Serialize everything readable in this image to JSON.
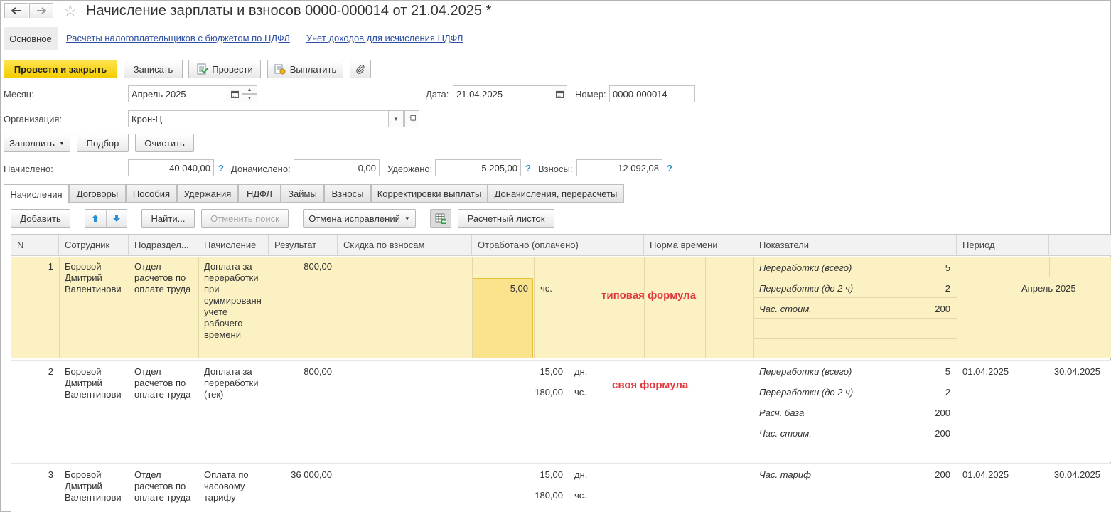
{
  "window": {
    "title": "Начисление зарплаты и взносов 0000-000014 от 21.04.2025 *"
  },
  "subnav": {
    "main": "Основное",
    "link1": "Расчеты налогоплательщиков с бюджетом по НДФЛ",
    "link2": "Учет доходов для исчисления НДФЛ"
  },
  "toolbar": {
    "post_close": "Провести и закрыть",
    "save": "Записать",
    "post": "Провести",
    "pay": "Выплатить"
  },
  "form": {
    "month_label": "Месяц:",
    "month_value": "Апрель 2025",
    "date_label": "Дата:",
    "date_value": "21.04.2025",
    "number_label": "Номер:",
    "number_value": "0000-000014",
    "org_label": "Организация:",
    "org_value": "Крон-Ц"
  },
  "actions": {
    "fill": "Заполнить",
    "pick": "Подбор",
    "clear": "Очистить"
  },
  "totals": {
    "accrued_label": "Начислено:",
    "accrued_value": "40 040,00",
    "additional_label": "Доначислено:",
    "additional_value": "0,00",
    "withheld_label": "Удержано:",
    "withheld_value": "5 205,00",
    "contributions_label": "Взносы:",
    "contributions_value": "12 092,08",
    "help": "?"
  },
  "tabs": [
    "Начисления",
    "Договоры",
    "Пособия",
    "Удержания",
    "НДФЛ",
    "Займы",
    "Взносы",
    "Корректировки выплаты",
    "Доначисления, перерасчеты"
  ],
  "table_toolbar": {
    "add": "Добавить",
    "find": "Найти...",
    "cancel_search": "Отменить поиск",
    "cancel_corrections": "Отмена исправлений",
    "payslip": "Расчетный листок"
  },
  "columns": [
    "N",
    "Сотрудник",
    "Подраздел...",
    "Начисление",
    "Результат",
    "Скидка по взносам",
    "Отработано (оплачено)",
    "Норма времени",
    "Показатели",
    "Период"
  ],
  "rows": [
    {
      "n": "1",
      "employee": "Боровой Дмитрий Валентинови",
      "dept": "Отдел расчетов по оплате труда",
      "accrual": "Доплата за переработки при суммированн учете рабочего времени",
      "result": "800,00",
      "worked": [
        {
          "value": "5,00",
          "unit": "чс."
        }
      ],
      "note": "типовая формула",
      "indicators": [
        {
          "name": "Переработки (всего)",
          "value": "5"
        },
        {
          "name": "Переработки (до 2 ч)",
          "value": "2"
        },
        {
          "name": "Час. стоим.",
          "value": "200"
        }
      ],
      "period": "Апрель 2025"
    },
    {
      "n": "2",
      "employee": "Боровой Дмитрий Валентинови",
      "dept": "Отдел расчетов по оплате труда",
      "accrual": "Доплата за переработки (тек)",
      "result": "800,00",
      "worked": [
        {
          "value": "15,00",
          "unit": "дн."
        },
        {
          "value": "180,00",
          "unit": "чс."
        }
      ],
      "note": "своя формула",
      "indicators": [
        {
          "name": "Переработки (всего)",
          "value": "5"
        },
        {
          "name": "Переработки (до 2 ч)",
          "value": "2"
        },
        {
          "name": "Расч. база",
          "value": "200"
        },
        {
          "name": "Час. стоим.",
          "value": "200"
        }
      ],
      "period_from": "01.04.2025",
      "period_to": "30.04.2025"
    },
    {
      "n": "3",
      "employee": "Боровой Дмитрий Валентинови",
      "dept": "Отдел расчетов по оплате труда",
      "accrual": "Оплата по часовому тарифу",
      "result": "36 000,00",
      "worked": [
        {
          "value": "15,00",
          "unit": "дн."
        },
        {
          "value": "180,00",
          "unit": "чс."
        }
      ],
      "indicators": [
        {
          "name": "Час. тариф",
          "value": "200"
        }
      ],
      "period_from": "01.04.2025",
      "period_to": "30.04.2025"
    }
  ]
}
